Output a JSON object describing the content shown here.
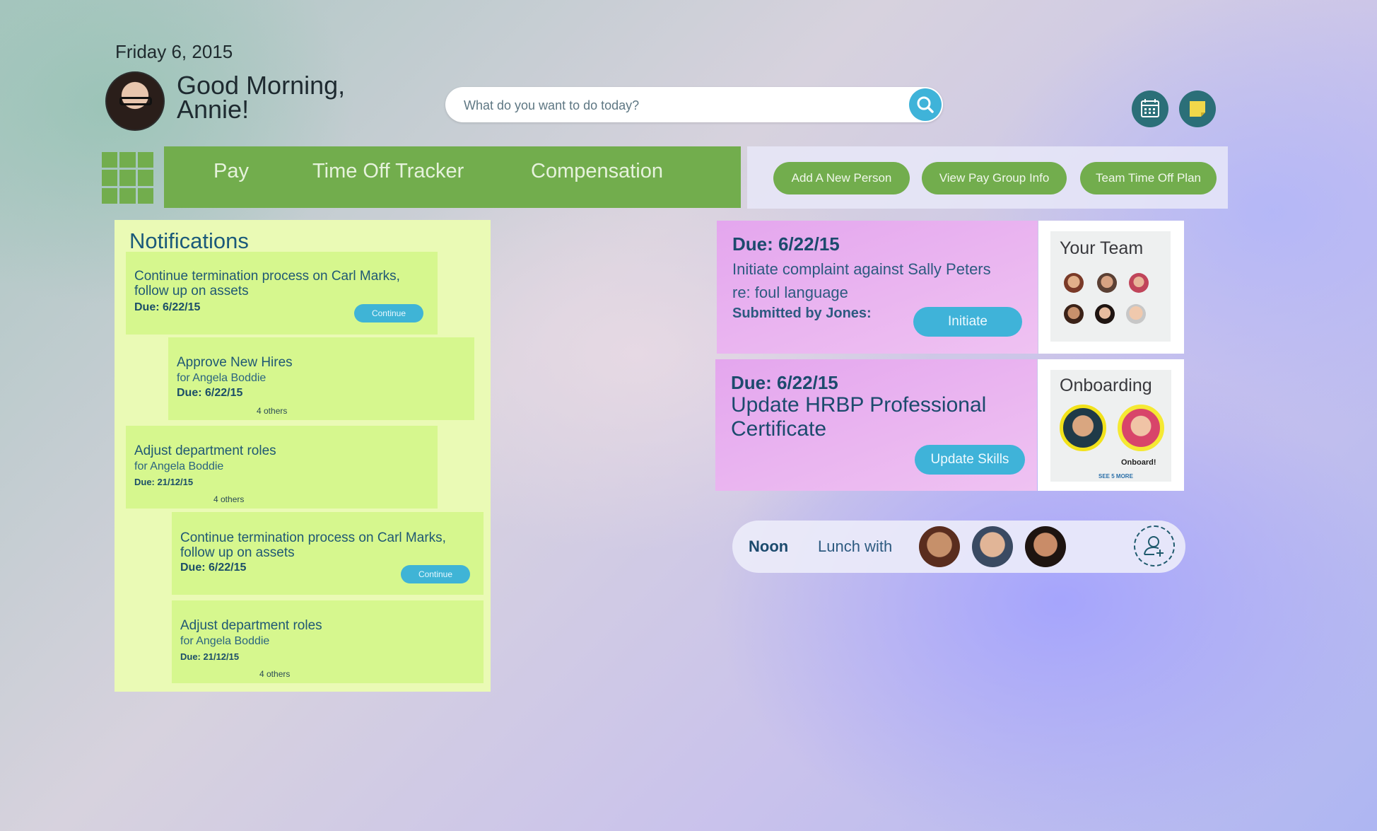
{
  "header": {
    "date": "Friday 6, 2015",
    "greeting_line1": "Good Morning,",
    "greeting_line2": "Annie!",
    "search_placeholder": "What do you want to do today?",
    "icons": [
      "search-icon",
      "calendar-icon",
      "sticky-note-icon",
      "apps-grid-icon"
    ]
  },
  "nav": {
    "items": [
      {
        "label": "Pay"
      },
      {
        "label": "Time Off Tracker"
      },
      {
        "label": "Compensation"
      }
    ]
  },
  "actions": [
    {
      "label": "Add A New Person"
    },
    {
      "label": "View Pay Group Info"
    },
    {
      "label": "Team Time Off Plan"
    }
  ],
  "notifications": {
    "title": "Notifications",
    "cards": [
      {
        "title": "Continue termination process on Carl Marks, follow up on assets",
        "due": "Due: 6/22/15",
        "button": "Continue"
      },
      {
        "title": "Approve New Hires",
        "sub": "for Angela Boddie",
        "due": "Due: 6/22/15",
        "others": "4 others"
      },
      {
        "title": "Adjust department roles",
        "sub": "for Angela Boddie",
        "due": "Due: 21/12/15",
        "others": "4 others"
      },
      {
        "title": "Continue termination process on Carl Marks, follow up on assets",
        "due": "Due: 6/22/15",
        "button": "Continue"
      },
      {
        "title": "Adjust department roles",
        "sub": "for Angela Boddie",
        "due": "Due: 21/12/15",
        "others": "4 others"
      }
    ]
  },
  "tasks": [
    {
      "due": "Due: 6/22/15",
      "text_line1": "Initiate complaint against Sally Peters",
      "text_line2": "re: foul language",
      "submitted": "Submitted by Jones:",
      "button": "Initiate"
    },
    {
      "due": "Due: 6/22/15",
      "text_line1": "Update HRBP Professional",
      "text_line2": "Certificate",
      "button": "Update Skills"
    }
  ],
  "team": {
    "title": "Your Team"
  },
  "onboarding": {
    "title": "Onboarding",
    "status": "Onboard!",
    "more": "SEE 5 MORE"
  },
  "lunch": {
    "time": "Noon",
    "label": "Lunch with",
    "icons": [
      "add-person-icon"
    ]
  },
  "colors": {
    "nav_green": "#72ad4d",
    "button_blue": "#3fb3d9",
    "notif_card": "#d6f78e",
    "task_pink": "#e4a6ee",
    "title_blue": "#1b5a7a"
  }
}
